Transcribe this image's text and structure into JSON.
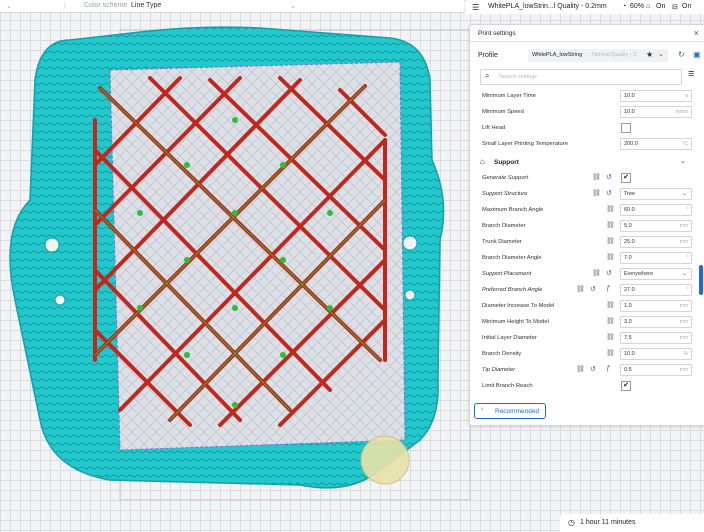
{
  "toolbar": {
    "color_scheme_label": "Color scheme",
    "color_scheme_value": "Line Type"
  },
  "status_bar": {
    "job_name": "WhitePLA_lowStrin...l Quality - 0.2mm",
    "infill_percent": "60%",
    "support_state": "On",
    "adhesion_state": "On"
  },
  "panel": {
    "title": "Print settings",
    "close_icon": "close-icon",
    "profile_label": "Profile",
    "profile_name": "WhitePLA_lowString",
    "profile_quality": "Normal Quality - 0.",
    "search_placeholder": "Search settings",
    "recommended_label": "Recommended"
  },
  "settings": {
    "rows_top": [
      {
        "label": "Minimum Layer Time",
        "value": "10.0",
        "unit": "s"
      },
      {
        "label": "Minimum Speed",
        "value": "10.0",
        "unit": "mm/s"
      },
      {
        "label": "Lift Head",
        "value": "",
        "unit": ""
      },
      {
        "label": "Small Layer Printing Temperature",
        "value": "200.0",
        "unit": "°C"
      }
    ],
    "support_section": "Support",
    "support_rows": [
      {
        "label": "Generate Support",
        "value": "✔",
        "unit": ""
      },
      {
        "label": "Support Structure",
        "value": "Tree",
        "unit": ""
      },
      {
        "label": "Maximum Branch Angle",
        "value": "60.0",
        "unit": "°"
      },
      {
        "label": "Branch Diameter",
        "value": "5.0",
        "unit": "mm"
      },
      {
        "label": "Trunk Diameter",
        "value": "25.0",
        "unit": "mm"
      },
      {
        "label": "Branch Diameter Angle",
        "value": "7.0",
        "unit": "°"
      },
      {
        "label": "Support Placement",
        "value": "Everywhere",
        "unit": ""
      },
      {
        "label": "Preferred Branch Angle",
        "value": "27.0",
        "unit": "°"
      },
      {
        "label": "Diameter Increase To Model",
        "value": "1.0",
        "unit": "mm"
      },
      {
        "label": "Minimum Height To Model",
        "value": "3.0",
        "unit": "mm"
      },
      {
        "label": "Initial Layer Diameter",
        "value": "7.5",
        "unit": "mm"
      },
      {
        "label": "Branch Density",
        "value": "10.0",
        "unit": "%"
      },
      {
        "label": "Tip Diameter",
        "value": "0.5",
        "unit": "mm"
      },
      {
        "label": "Limit Branch Reach",
        "value": "✔",
        "unit": ""
      }
    ]
  },
  "print_time": "1 hour 11 minutes",
  "colors": {
    "accent": "#1e6ad6",
    "skirt": "#1fc4c8",
    "wall": "#c0271d",
    "inner_wall": "#2dbf33",
    "support": "#e8e2a8"
  }
}
